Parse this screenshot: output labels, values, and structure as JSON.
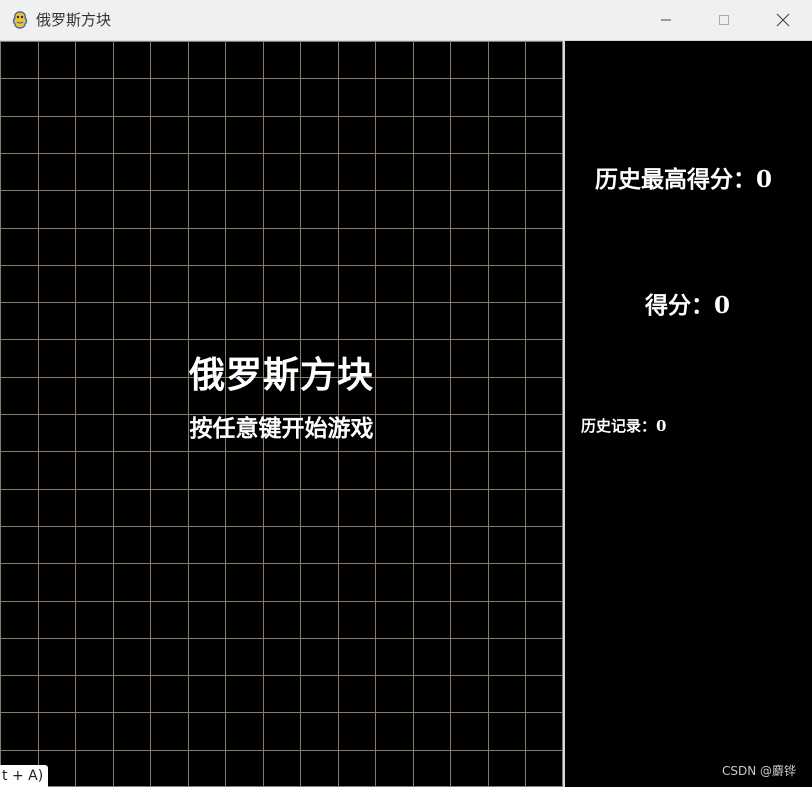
{
  "window": {
    "title": "俄罗斯方块",
    "icon": "pygame-snake-icon",
    "controls": {
      "minimize": "minimize-icon",
      "maximize": "maximize-icon",
      "close": "close-icon"
    }
  },
  "game": {
    "title": "俄罗斯方块",
    "prompt": "按任意键开始游戏",
    "grid": {
      "columns": 15,
      "rows": 20,
      "line_color": "#8a7a6a",
      "background": "#000000"
    }
  },
  "panel": {
    "high_score_label": "历史最高得分：",
    "high_score_value": "0",
    "score_label": "得分：",
    "score_value": "0",
    "history_label": "历史记录：",
    "history_value": "0"
  },
  "overlay": {
    "watermark": "CSDN @麝铧",
    "shortcut_hint": "t + A)"
  },
  "colors": {
    "text": "#ffffff",
    "titlebar": "#f0f0f0",
    "divider": "#d9d9d9"
  }
}
